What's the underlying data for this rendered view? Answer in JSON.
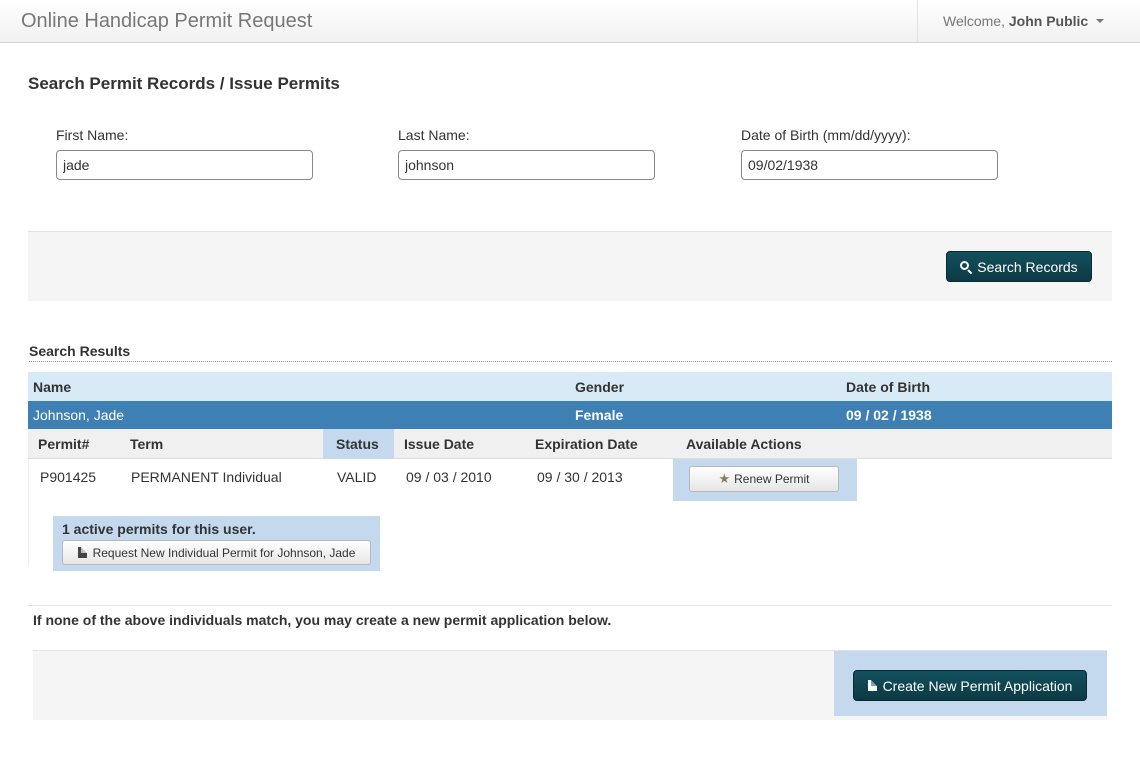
{
  "navbar": {
    "brand": "Online Handicap Permit Request",
    "welcome_prefix": "Welcome,",
    "user_name": "John Public"
  },
  "page_title": "Search Permit Records / Issue Permits",
  "search_form": {
    "first_name": {
      "label": "First Name:",
      "value": "jade"
    },
    "last_name": {
      "label": "Last Name:",
      "value": "johnson"
    },
    "dob": {
      "label": "Date of Birth (mm/dd/yyyy):",
      "value": "09/02/1938"
    },
    "search_button": "Search Records"
  },
  "results": {
    "heading": "Search Results",
    "columns": {
      "name": "Name",
      "gender": "Gender",
      "dob": "Date of Birth"
    },
    "person": {
      "name": "Johnson, Jade",
      "gender": "Female",
      "dob": "09 / 02 / 1938"
    },
    "permit_columns": {
      "permit": "Permit#",
      "term": "Term",
      "status": "Status",
      "issue_date": "Issue Date",
      "expiration_date": "Expiration Date",
      "actions": "Available Actions"
    },
    "permits": [
      {
        "permit": "P901425",
        "term": "PERMANENT Individual",
        "status": "VALID",
        "issue_date": "09 / 03 / 2010",
        "expiration_date": "09 / 30 / 2013",
        "action": "Renew Permit"
      }
    ],
    "active_count_text": "1 active permits for this user.",
    "request_button": "Request New Individual Permit for Johnson, Jade"
  },
  "none_match_text": "If none of the above individuals match, you may create a new permit application below.",
  "create_button": "Create New Permit Application",
  "icons": {
    "search": "search-icon",
    "star": "star-icon",
    "document": "document-icon",
    "caret": "caret-down-icon"
  }
}
